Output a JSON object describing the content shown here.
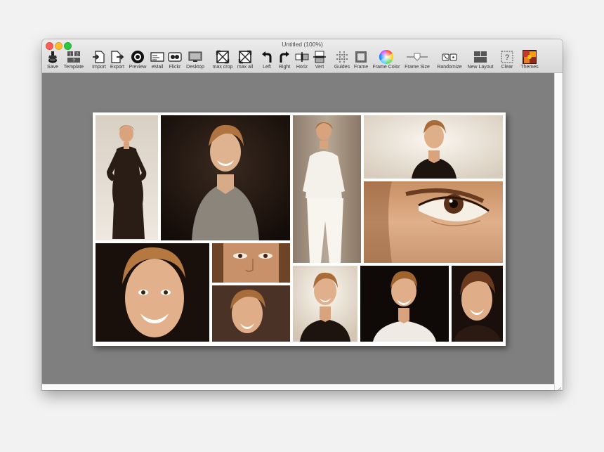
{
  "window": {
    "title": "Untitled (100%)",
    "colors": {
      "canvas_background": "#7f7f7f",
      "board_background": "#ffffff",
      "close": "#fc5f57",
      "minimize": "#fdbc2e",
      "maximize": "#28c840"
    }
  },
  "toolbar": [
    {
      "id": "save",
      "label": "Save",
      "icon": "save-icon"
    },
    {
      "id": "template",
      "label": "Template",
      "icon": "template-icon"
    },
    {
      "id": "import",
      "label": "Import",
      "icon": "import-icon"
    },
    {
      "id": "export",
      "label": "Export",
      "icon": "export-icon"
    },
    {
      "id": "preview",
      "label": "Preview",
      "icon": "preview-icon"
    },
    {
      "id": "email",
      "label": "eMail",
      "icon": "email-icon"
    },
    {
      "id": "flickr",
      "label": "Flickr",
      "icon": "flickr-icon"
    },
    {
      "id": "desktop",
      "label": "Desktop",
      "icon": "desktop-icon"
    },
    {
      "id": "max-crop",
      "label": "max crop",
      "icon": "max-crop-icon"
    },
    {
      "id": "max-all",
      "label": "max all",
      "icon": "max-all-icon"
    },
    {
      "id": "left",
      "label": "Left",
      "icon": "rotate-left-icon"
    },
    {
      "id": "right",
      "label": "Right",
      "icon": "rotate-right-icon"
    },
    {
      "id": "horiz",
      "label": "Horiz",
      "icon": "flip-horizontal-icon"
    },
    {
      "id": "vert",
      "label": "Vert",
      "icon": "flip-vertical-icon"
    },
    {
      "id": "guides",
      "label": "Guides",
      "icon": "guides-icon"
    },
    {
      "id": "frame",
      "label": "Frame",
      "icon": "frame-icon"
    },
    {
      "id": "frame-color",
      "label": "Frame Color",
      "icon": "color-wheel-icon"
    },
    {
      "id": "frame-size",
      "label": "Frame Size",
      "icon": "slider-icon"
    },
    {
      "id": "randomize",
      "label": "Randomize",
      "icon": "dice-icon"
    },
    {
      "id": "new-layout",
      "label": "New Layout",
      "icon": "new-layout-icon"
    },
    {
      "id": "clear",
      "label": "Clear",
      "icon": "clear-icon"
    },
    {
      "id": "themes",
      "label": "Themes",
      "icon": "themes-icon"
    }
  ],
  "photos": [
    {
      "id": "woman-black-dress-full-body",
      "bg": "light"
    },
    {
      "id": "woman-grey-sweater-smiling",
      "bg": "dark"
    },
    {
      "id": "woman-white-outfit-standing",
      "bg": "light"
    },
    {
      "id": "woman-black-top-smiling",
      "bg": "light"
    },
    {
      "id": "eye-closeup",
      "bg": "skin"
    },
    {
      "id": "face-closeup-smiling",
      "bg": "dark"
    },
    {
      "id": "face-eyes-nose-crop",
      "bg": "skin"
    },
    {
      "id": "woman-looking-up-smiling",
      "bg": "dark"
    },
    {
      "id": "woman-portrait-light-background",
      "bg": "light"
    },
    {
      "id": "woman-laughing-white-top",
      "bg": "dark"
    },
    {
      "id": "woman-portrait-right-edge",
      "bg": "dark"
    }
  ]
}
